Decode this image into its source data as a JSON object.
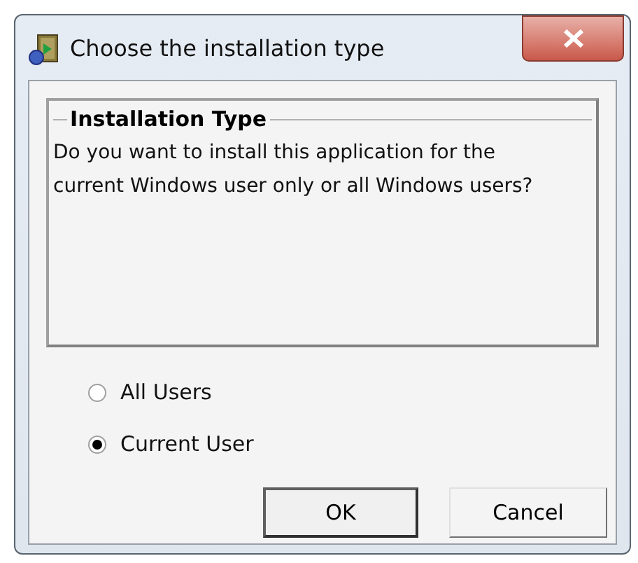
{
  "window": {
    "title": "Choose the installation type"
  },
  "group": {
    "title": "Installation Type",
    "message": "Do you want to install this application for the current Windows user only or all Windows users?"
  },
  "options": [
    {
      "label": "All Users",
      "selected": false
    },
    {
      "label": "Current User",
      "selected": true
    }
  ],
  "buttons": [
    {
      "label": "OK",
      "default": true
    },
    {
      "label": "Cancel",
      "default": false
    }
  ]
}
